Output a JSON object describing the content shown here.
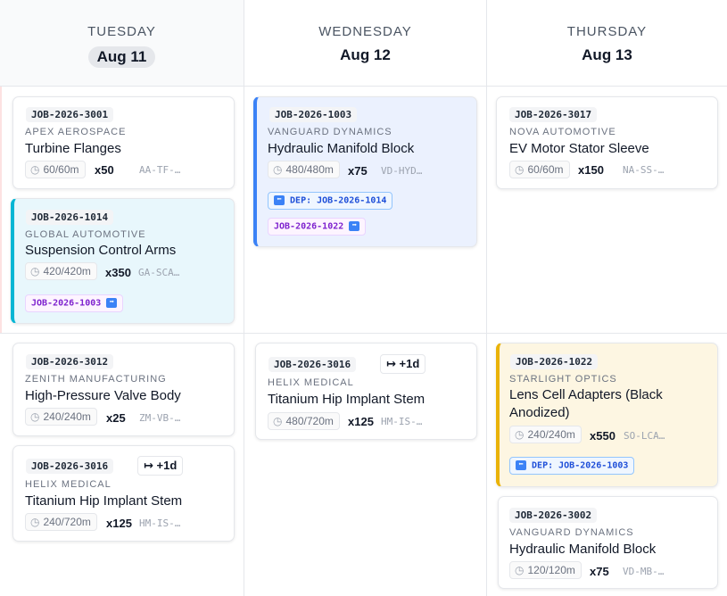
{
  "days": [
    {
      "name": "TUESDAY",
      "date": "Aug 11"
    },
    {
      "name": "WEDNESDAY",
      "date": "Aug 12"
    },
    {
      "name": "THURSDAY",
      "date": "Aug 13"
    }
  ],
  "cards": {
    "c3001": {
      "id": "JOB-2026-3001",
      "customer": "APEX AEROSPACE",
      "title": "Turbine Flanges",
      "time": "60/60m",
      "qty": "x50",
      "part": "AA-TF-…"
    },
    "c1014": {
      "id": "JOB-2026-1014",
      "customer": "GLOBAL AUTOMOTIVE",
      "title": "Suspension Control Arms",
      "time": "420/420m",
      "qty": "x350",
      "part": "GA-SCA…",
      "successor": "JOB-2026-1003"
    },
    "c1003": {
      "id": "JOB-2026-1003",
      "customer": "VANGUARD DYNAMICS",
      "title": "Hydraulic Manifold Block",
      "time": "480/480m",
      "qty": "x75",
      "part": "VD-HYD…",
      "dependency": "DEP: JOB-2026-1014",
      "successor": "JOB-2026-1022"
    },
    "c3017": {
      "id": "JOB-2026-3017",
      "customer": "NOVA AUTOMOTIVE",
      "title": "EV Motor Stator Sleeve",
      "time": "60/60m",
      "qty": "x150",
      "part": "NA-SS-…"
    },
    "c3012": {
      "id": "JOB-2026-3012",
      "customer": "ZENITH MANUFACTURING",
      "title": "High-Pressure Valve Body",
      "time": "240/240m",
      "qty": "x25",
      "part": "ZM-VB-…"
    },
    "c3016a": {
      "id": "JOB-2026-3016",
      "shift": "+1d",
      "customer": "HELIX MEDICAL",
      "title": "Titanium Hip Implant Stem",
      "time": "240/720m",
      "qty": "x125",
      "part": "HM-IS-…"
    },
    "c3016b": {
      "id": "JOB-2026-3016",
      "shift": "+1d",
      "customer": "HELIX MEDICAL",
      "title": "Titanium Hip Implant Stem",
      "time": "480/720m",
      "qty": "x125",
      "part": "HM-IS-…"
    },
    "c1022": {
      "id": "JOB-2026-1022",
      "customer": "STARLIGHT OPTICS",
      "title": "Lens Cell Adapters (Black Anodized)",
      "time": "240/240m",
      "qty": "x550",
      "part": "SO-LCA…",
      "dependency": "DEP: JOB-2026-1003"
    },
    "c3002": {
      "id": "JOB-2026-3002",
      "customer": "VANGUARD DYNAMICS",
      "title": "Hydraulic Manifold Block",
      "time": "120/120m",
      "qty": "x75",
      "part": "VD-MB-…"
    }
  },
  "icons": {
    "clock": "clock-icon",
    "arrow_right": "arrow-right-icon",
    "arrow_left": "arrow-left-icon",
    "shift": "shift-right-icon"
  },
  "colors": {
    "accent_blue": "#3b82f6",
    "accent_cyan": "#06b6d4",
    "accent_amber": "#eab308"
  }
}
